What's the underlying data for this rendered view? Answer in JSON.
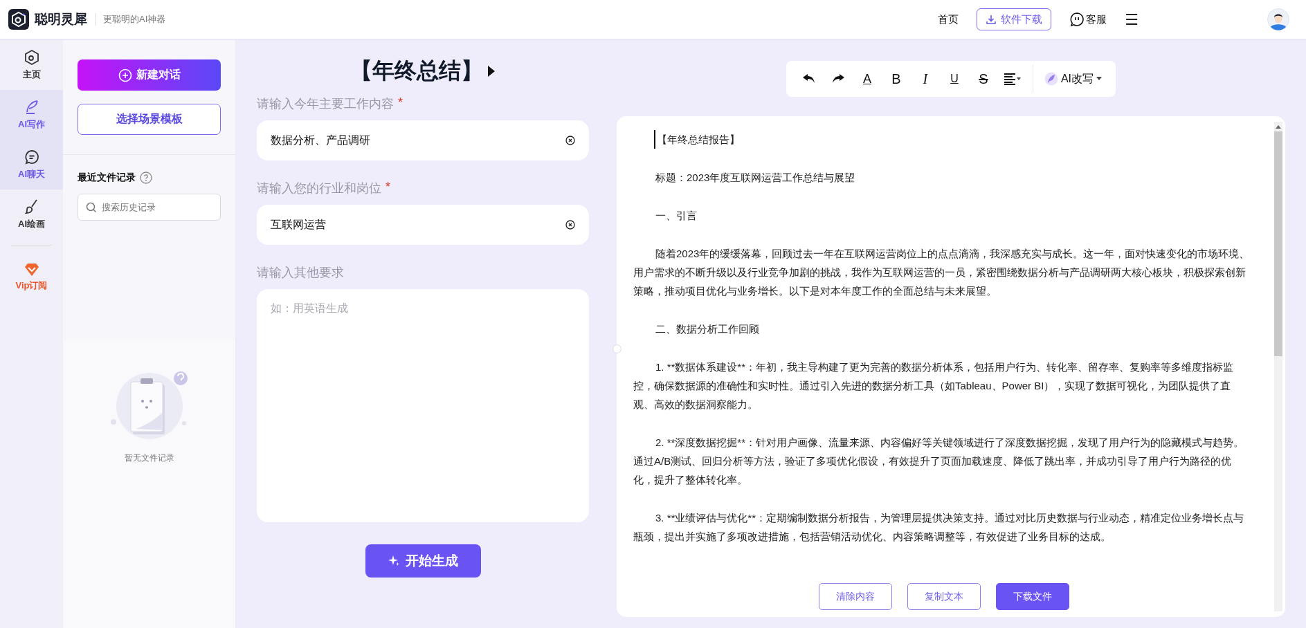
{
  "header": {
    "brand": "聪明灵犀",
    "slogan": "更聪明的AI神器",
    "nav": [
      {
        "kind": "link",
        "label": "首页"
      },
      {
        "kind": "download",
        "label": "软件下载"
      },
      {
        "kind": "service",
        "label": "客服"
      },
      {
        "kind": "menu",
        "label": "☰"
      }
    ]
  },
  "rail": [
    {
      "kind": "home",
      "label": "主页",
      "selected": false
    },
    {
      "kind": "write",
      "label": "AI写作",
      "selected": true
    },
    {
      "kind": "chat",
      "label": "AI聊天",
      "selected": true
    },
    {
      "kind": "paint",
      "label": "AI绘画",
      "selected": false
    },
    {
      "kind": "vip",
      "label": "Vip订阅",
      "selected": false
    }
  ],
  "sidebar": {
    "new_chat": "新建对话",
    "template": "选择场景模板",
    "recent_title": "最近文件记录",
    "search_placeholder": "搜索历史记录",
    "empty_text": "暂无文件记录"
  },
  "form": {
    "title": "【年终总结】",
    "fields": [
      {
        "kind": "input",
        "label": "请输入今年主要工作内容",
        "required_mark": "*",
        "value": "数据分析、产品调研"
      },
      {
        "kind": "input",
        "label": "请输入您的行业和岗位",
        "required_mark": "*",
        "value": "互联网运营"
      },
      {
        "kind": "textarea",
        "label": "请输入其他要求",
        "placeholder": "如：用英语生成"
      }
    ],
    "generate": "开始生成"
  },
  "editor": {
    "tools": [
      {
        "kind": "undo"
      },
      {
        "kind": "redo"
      },
      {
        "kind": "color",
        "label": "A"
      },
      {
        "kind": "bold",
        "label": "B"
      },
      {
        "kind": "italic",
        "label": "I"
      },
      {
        "kind": "underline",
        "label": "U"
      },
      {
        "kind": "strike",
        "label": "S"
      },
      {
        "kind": "align"
      }
    ],
    "ai_rewrite": "AI改写",
    "paragraphs": [
      "【年终总结报告】",
      "标题：2023年度互联网运营工作总结与展望",
      "一、引言",
      "随着2023年的缓缓落幕，回顾过去一年在互联网运营岗位上的点点滴滴，我深感充实与成长。这一年，面对快速变化的市场环境、用户需求的不断升级以及行业竞争加剧的挑战，我作为互联网运营的一员，紧密围绕数据分析与产品调研两大核心板块，积极探索创新策略，推动项目优化与业务增长。以下是对本年度工作的全面总结与未来展望。",
      "二、数据分析工作回顾",
      "1. **数据体系建设**：年初，我主导构建了更为完善的数据分析体系，包括用户行为、转化率、留存率、复购率等多维度指标监控，确保数据源的准确性和实时性。通过引入先进的数据分析工具（如Tableau、Power BI），实现了数据可视化，为团队提供了直观、高效的数据洞察能力。",
      "2. **深度数据挖掘**：针对用户画像、流量来源、内容偏好等关键领域进行了深度数据挖掘，发现了用户行为的隐藏模式与趋势。通过A/B测试、回归分析等方法，验证了多项优化假设，有效提升了页面加载速度、降低了跳出率，并成功引导了用户行为路径的优化，提升了整体转化率。",
      "3. **业绩评估与优化**：定期编制数据分析报告，为管理层提供决策支持。通过对比历史数据与行业动态，精准定位业务增长点与瓶颈，提出并实施了多项改进措施，包括营销活动优化、内容策略调整等，有效促进了业务目标的达成。"
    ],
    "buttons": [
      {
        "label": "清除内容",
        "primary": false
      },
      {
        "label": "复制文本",
        "primary": false
      },
      {
        "label": "下载文件",
        "primary": true
      }
    ]
  }
}
